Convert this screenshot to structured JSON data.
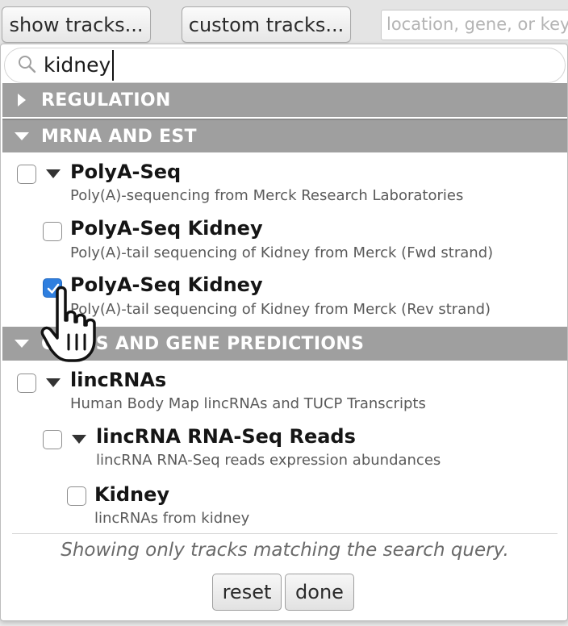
{
  "toolbar": {
    "show_tracks_label": "show tracks...",
    "custom_tracks_label": "custom tracks...",
    "location_placeholder": "location, gene, or keyw"
  },
  "search": {
    "query": "kidney"
  },
  "groups": {
    "regulation": {
      "label": "REGULATION"
    },
    "mrna": {
      "label": "MRNA AND EST",
      "tracks": [
        {
          "title": "PolyA-Seq",
          "desc": "Poly(A)-sequencing from Merck Research Laboratories",
          "checked": false
        },
        {
          "title": "PolyA-Seq Kidney",
          "desc": "Poly(A)-tail sequencing of Kidney from Merck (Fwd strand)",
          "checked": false
        },
        {
          "title": "PolyA-Seq Kidney",
          "desc": "Poly(A)-tail sequencing of Kidney from Merck (Rev strand)",
          "checked": true
        }
      ]
    },
    "genes": {
      "label": "GENES AND GENE PREDICTIONS",
      "tracks": [
        {
          "title": "lincRNAs",
          "desc": "Human Body Map lincRNAs and TUCP Transcripts",
          "checked": false
        },
        {
          "title": "lincRNA RNA-Seq Reads",
          "desc": "lincRNA RNA-Seq reads expression abundances",
          "checked": false
        },
        {
          "title": "Kidney",
          "desc": "lincRNAs from kidney",
          "checked": false
        }
      ]
    }
  },
  "footer": {
    "note": "Showing only tracks matching the search query.",
    "reset_label": "reset",
    "done_label": "done"
  },
  "colors": {
    "group_header_bg": "#9f9f9f",
    "checkbox_checked": "#2f7fdf"
  }
}
